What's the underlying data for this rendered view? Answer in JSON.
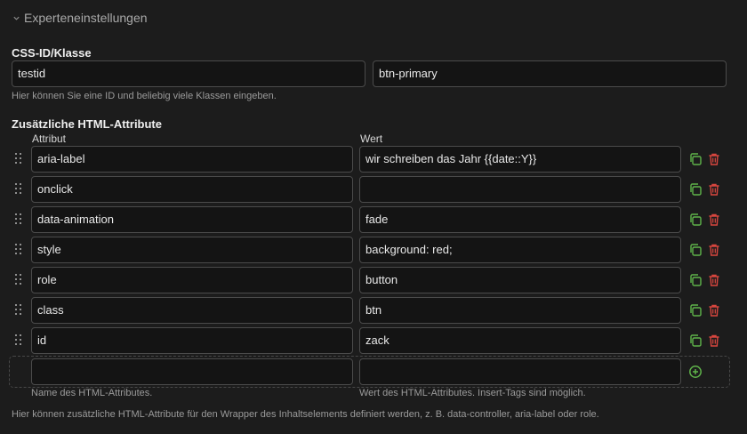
{
  "section": {
    "legend": "Experteneinstellungen"
  },
  "css_id": {
    "label": "CSS-ID/Klasse",
    "id_value": "testid",
    "class_value": "btn-primary",
    "help": "Hier können Sie eine ID und beliebig viele Klassen eingeben."
  },
  "attributes": {
    "label": "Zusätzliche HTML-Attribute",
    "col_attr": "Attribut",
    "col_value": "Wert",
    "rows": [
      {
        "name": "aria-label",
        "value": "wir schreiben das Jahr {{date::Y}}"
      },
      {
        "name": "onclick",
        "value": ""
      },
      {
        "name": "data-animation",
        "value": "fade"
      },
      {
        "name": "style",
        "value": "background: red;"
      },
      {
        "name": "role",
        "value": "button"
      },
      {
        "name": "class",
        "value": "btn"
      },
      {
        "name": "id",
        "value": "zack"
      }
    ],
    "new_row": {
      "name": "",
      "value": ""
    },
    "help_attr": "Name des HTML-Attributes.",
    "help_value": "Wert des HTML-Attributes. Insert-Tags sind möglich.",
    "help_main": "Hier können zusätzliche HTML-Attribute für den Wrapper des Inhaltselements definiert werden, z. B. data-controller, aria-label oder role."
  },
  "colors": {
    "copy_icon": "#5fb34a",
    "delete_icon": "#d9463f",
    "add_icon": "#5fb34a"
  }
}
